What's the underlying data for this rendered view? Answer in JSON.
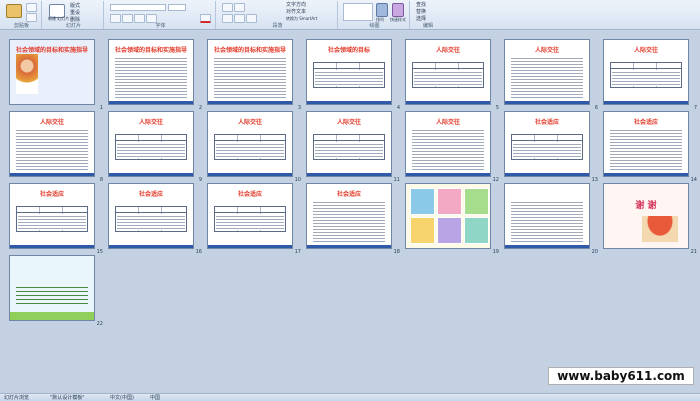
{
  "ribbon": {
    "groups": [
      {
        "label": "剪贴板"
      },
      {
        "label": "幻灯片"
      },
      {
        "label": "字体"
      },
      {
        "label": "段落"
      },
      {
        "label": "绘图"
      },
      {
        "label": "编辑"
      }
    ],
    "buttons": {
      "new_slide": "新建\n幻灯片",
      "layout": "版式",
      "reset": "重设",
      "delete": "删除",
      "text_direction": "文字方向",
      "align_text": "对齐文本",
      "convert_smartart": "转换为 SmartArt",
      "arrange": "排列",
      "quick_styles": "快速样式",
      "find": "查找",
      "replace": "替换",
      "select": "选择"
    }
  },
  "slides": [
    {
      "num": "1",
      "title": "社会领域的目标和实施指导",
      "kind": "cover"
    },
    {
      "num": "2",
      "title": "社会领域的目标和实施指导",
      "kind": "text"
    },
    {
      "num": "3",
      "title": "社会领域的目标和实施指导",
      "kind": "text"
    },
    {
      "num": "4",
      "title": "社会领域的目标",
      "kind": "goals"
    },
    {
      "num": "5",
      "title": "人际交往",
      "kind": "table"
    },
    {
      "num": "6",
      "title": "人际交往",
      "kind": "text"
    },
    {
      "num": "7",
      "title": "人际交往",
      "kind": "table"
    },
    {
      "num": "8",
      "title": "人际交往",
      "kind": "text"
    },
    {
      "num": "9",
      "title": "人际交往",
      "kind": "table"
    },
    {
      "num": "10",
      "title": "人际交往",
      "kind": "table"
    },
    {
      "num": "11",
      "title": "人际交往",
      "kind": "table"
    },
    {
      "num": "12",
      "title": "人际交往",
      "kind": "text"
    },
    {
      "num": "13",
      "title": "社会适应",
      "kind": "table"
    },
    {
      "num": "14",
      "title": "社会适应",
      "kind": "text"
    },
    {
      "num": "15",
      "title": "社会适应",
      "kind": "table"
    },
    {
      "num": "16",
      "title": "社会适应",
      "kind": "table"
    },
    {
      "num": "17",
      "title": "社会适应",
      "kind": "table"
    },
    {
      "num": "18",
      "title": "社会适应",
      "kind": "text"
    },
    {
      "num": "19",
      "title": "",
      "kind": "pictures"
    },
    {
      "num": "20",
      "title": "",
      "kind": "text"
    },
    {
      "num": "21",
      "title": "谢 谢",
      "kind": "thanks"
    },
    {
      "num": "22",
      "title": "",
      "kind": "closing"
    }
  ],
  "status": {
    "slide_info": "幻灯片浏览",
    "theme": "\"默认设计模板\"",
    "language": "中文(中国)",
    "zoom": "中国"
  },
  "watermark": "www.baby611.com",
  "colors": {
    "title_red": "#e23a2a",
    "accent_blue": "#2f5aa8",
    "background": "#c3d1e3"
  }
}
